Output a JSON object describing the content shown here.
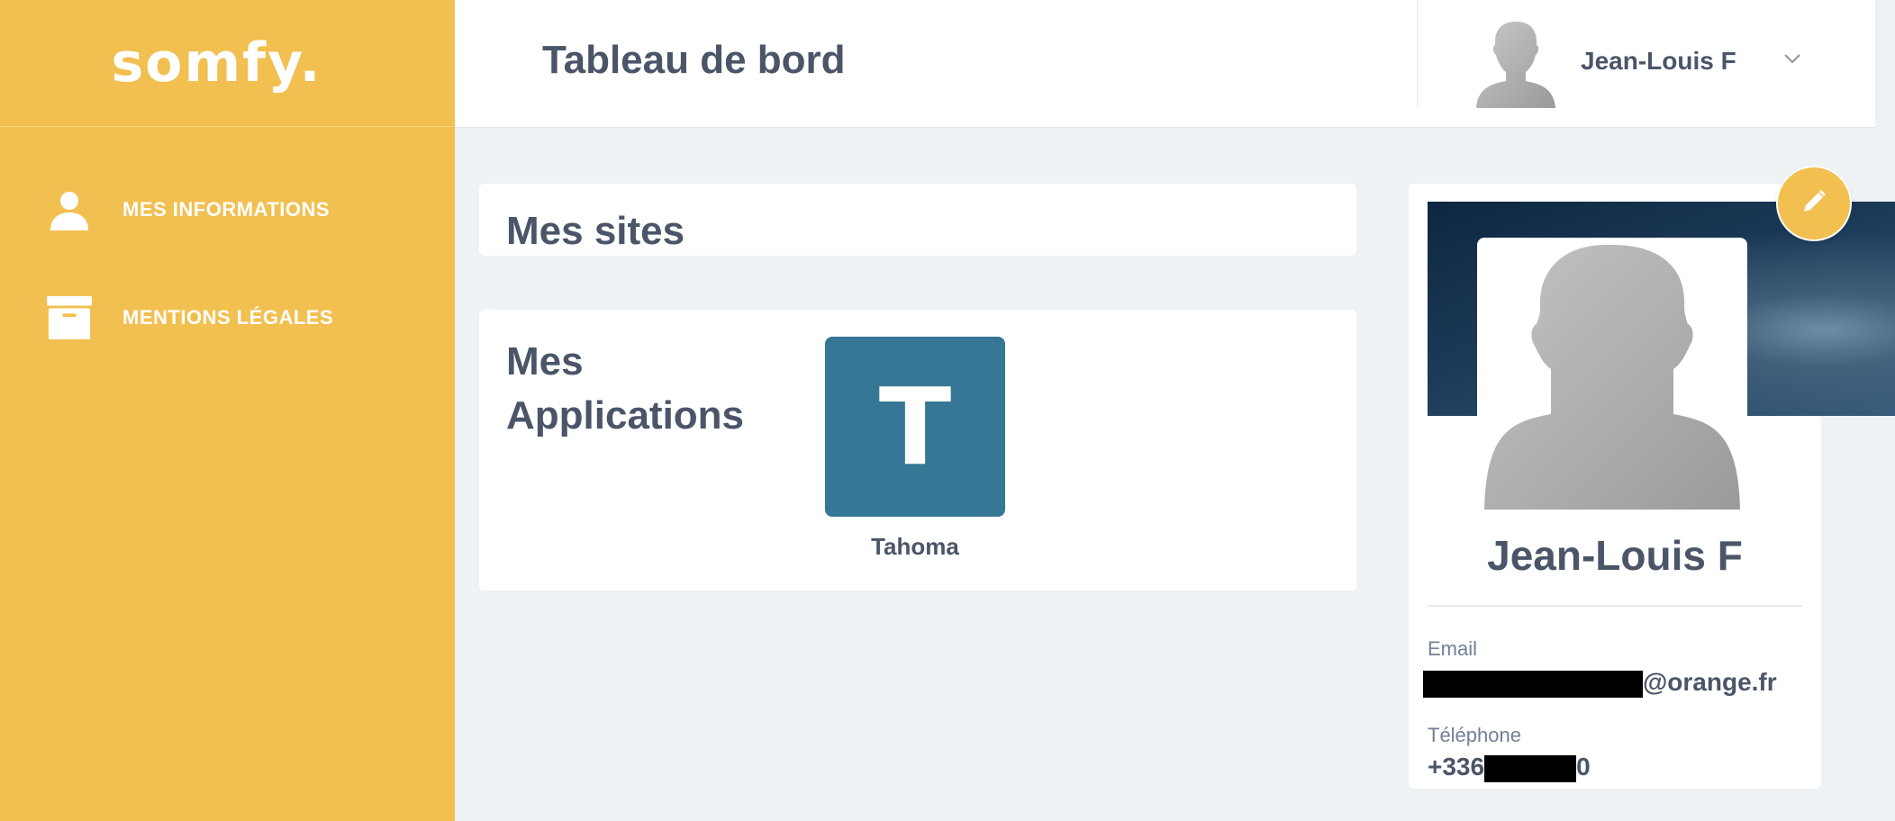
{
  "brand": {
    "logo_text": "somfy."
  },
  "sidebar": {
    "items": [
      {
        "label": "MES INFORMATIONS",
        "icon": "user-icon"
      },
      {
        "label": "MENTIONS LÉGALES",
        "icon": "archive-box-icon"
      }
    ]
  },
  "header": {
    "title": "Tableau de bord",
    "user_name": "Jean-Louis F"
  },
  "sites": {
    "title": "Mes sites"
  },
  "applications": {
    "title": "Mes Applications",
    "items": [
      {
        "letter": "T",
        "name": "Tahoma",
        "color": "#357794"
      }
    ]
  },
  "profile": {
    "name": "Jean-Louis F",
    "email_label": "Email",
    "email_suffix": "@orange.fr",
    "phone_label": "Téléphone",
    "phone_prefix": "+336",
    "phone_suffix": "0"
  },
  "colors": {
    "accent": "#f2c050",
    "app_tile": "#357794",
    "text": "#4a5568",
    "background": "#eef2f5"
  }
}
